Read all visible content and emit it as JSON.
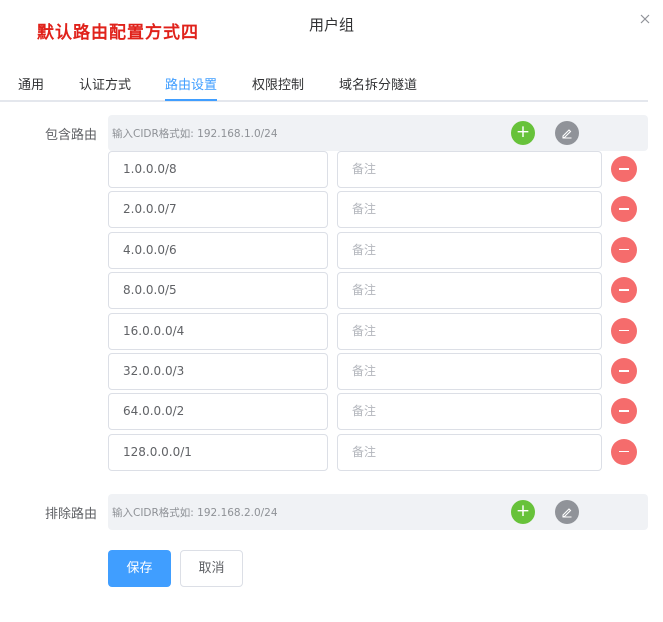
{
  "annotation": "默认路由配置方式四",
  "dialog": {
    "title": "用户组"
  },
  "tabs": [
    {
      "label": "通用",
      "active": false
    },
    {
      "label": "认证方式",
      "active": false
    },
    {
      "label": "路由设置",
      "active": true
    },
    {
      "label": "权限控制",
      "active": false
    },
    {
      "label": "域名拆分隧道",
      "active": false
    }
  ],
  "include_routes": {
    "label": "包含路由",
    "placeholder": "输入CIDR格式如: 192.168.1.0/24",
    "note_placeholder": "备注",
    "rows": [
      {
        "cidr": "1.0.0.0/8",
        "note": ""
      },
      {
        "cidr": "2.0.0.0/7",
        "note": ""
      },
      {
        "cidr": "4.0.0.0/6",
        "note": ""
      },
      {
        "cidr": "8.0.0.0/5",
        "note": ""
      },
      {
        "cidr": "16.0.0.0/4",
        "note": ""
      },
      {
        "cidr": "32.0.0.0/3",
        "note": ""
      },
      {
        "cidr": "64.0.0.0/2",
        "note": ""
      },
      {
        "cidr": "128.0.0.0/1",
        "note": ""
      }
    ]
  },
  "exclude_routes": {
    "label": "排除路由",
    "placeholder": "输入CIDR格式如: 192.168.2.0/24"
  },
  "buttons": {
    "save": "保存",
    "cancel": "取消"
  },
  "colors": {
    "accent": "#409eff",
    "add": "#67c23a",
    "edit": "#909399",
    "remove": "#f56c6c",
    "annotation": "#e0221b"
  },
  "icons": {
    "close": "close-icon",
    "add": "plus-icon",
    "edit": "edit-icon",
    "remove": "minus-icon"
  }
}
